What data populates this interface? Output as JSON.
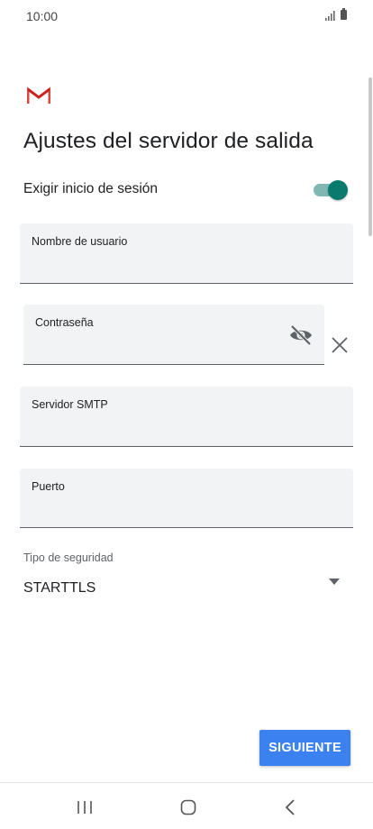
{
  "status_bar": {
    "time": "10:00",
    "icons": [
      "signal-icon",
      "battery-icon"
    ]
  },
  "header": {
    "logo_icon": "gmail-logo-icon",
    "title": "Ajustes del servidor de salida"
  },
  "require_login": {
    "label": "Exigir inicio de sesión",
    "enabled": true,
    "accent_color": "#0b7a6e"
  },
  "fields": {
    "username": {
      "label": "Nombre de usuario",
      "value": ""
    },
    "password": {
      "label": "Contraseña",
      "value": "",
      "visibility_icon": "eye-off-icon",
      "clear_icon": "close-icon"
    },
    "smtp_server": {
      "label": "Servidor SMTP",
      "value": ""
    },
    "port": {
      "label": "Puerto",
      "value": ""
    }
  },
  "security": {
    "label": "Tipo de seguridad",
    "selected": "STARTTLS",
    "icon": "dropdown-arrow-icon"
  },
  "actions": {
    "next_label": "SIGUIENTE",
    "next_color": "#3b82f0"
  },
  "nav_bar": {
    "icons": [
      "recents-icon",
      "home-icon",
      "back-icon"
    ]
  }
}
